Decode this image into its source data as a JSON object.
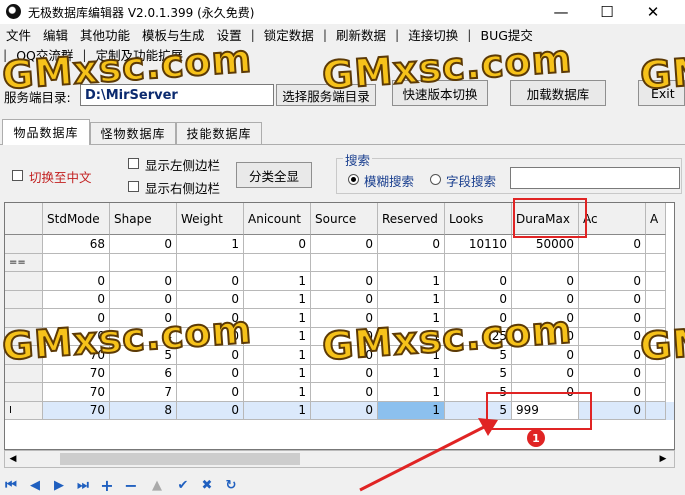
{
  "window": {
    "title": "无极数据库编辑器 V2.0.1.399 (永久免费)"
  },
  "menu_row1": [
    "文件",
    "编辑",
    "其他功能",
    "模板与生成",
    "设置",
    "锁定数据",
    "刷新数据",
    "连接切换",
    "BUG提交"
  ],
  "menu_row2": [
    "QQ交流群",
    "定制及功能扩展"
  ],
  "server_dir": {
    "label": "服务端目录:",
    "value": "D:\\MirServer",
    "select_button": "选择服务端目录",
    "quick_switch_button": "快速版本切换",
    "load_db_button": "加载数据库",
    "right_button": "Exit"
  },
  "tabs": [
    "物品数据库",
    "怪物数据库",
    "技能数据库"
  ],
  "options": {
    "switch_chinese": "切换至中文",
    "show_left_sidebar": "显示左侧边栏",
    "show_right_sidebar": "显示右侧边栏",
    "show_all_categories_button": "分类全显"
  },
  "search": {
    "group_label": "搜索",
    "fuzzy": "模糊搜索",
    "field": "字段搜索",
    "query": ""
  },
  "grid": {
    "columns": [
      "",
      "StdMode",
      "Shape",
      "Weight",
      "Anicount",
      "Source",
      "Reserved",
      "Looks",
      "DuraMax",
      "Ac",
      "A"
    ],
    "rows": [
      {
        "indicator": "",
        "cells": [
          "68",
          "0",
          "1",
          "0",
          "0",
          "0",
          "10110",
          "50000",
          "0",
          ""
        ]
      },
      {
        "indicator": "==",
        "cells": [
          "",
          "",
          "",
          "",
          "",
          "",
          "",
          "",
          "",
          ""
        ]
      },
      {
        "indicator": "",
        "cells": [
          "0",
          "0",
          "0",
          "1",
          "0",
          "1",
          "0",
          "0",
          "0",
          ""
        ]
      },
      {
        "indicator": "",
        "cells": [
          "0",
          "0",
          "0",
          "1",
          "0",
          "1",
          "0",
          "0",
          "0",
          ""
        ]
      },
      {
        "indicator": "",
        "cells": [
          "0",
          "0",
          "0",
          "1",
          "0",
          "1",
          "0",
          "0",
          "0",
          ""
        ]
      },
      {
        "indicator": "",
        "cells": [
          "0",
          "4",
          "0",
          "1",
          "0",
          "1",
          "25",
          "0",
          "0",
          ""
        ]
      },
      {
        "indicator": "",
        "cells": [
          "70",
          "5",
          "0",
          "1",
          "0",
          "1",
          "5",
          "0",
          "0",
          ""
        ]
      },
      {
        "indicator": "",
        "cells": [
          "70",
          "6",
          "0",
          "1",
          "0",
          "1",
          "5",
          "0",
          "0",
          ""
        ]
      },
      {
        "indicator": "",
        "cells": [
          "70",
          "7",
          "0",
          "1",
          "0",
          "1",
          "5",
          "0",
          "0",
          ""
        ]
      },
      {
        "indicator": "I",
        "cells": [
          "70",
          "8",
          "0",
          "1",
          "0",
          "1",
          "5",
          "999",
          "0",
          ""
        ]
      }
    ]
  },
  "annotation": {
    "badge": "1"
  },
  "watermark": "GMxsc.com",
  "colors": {
    "accent": "#1f5fbf",
    "highlight": "#e02424",
    "selected_row": "#dbe9fb",
    "selected_cell": "#8cc0ee",
    "watermark": "#f6c21a"
  }
}
